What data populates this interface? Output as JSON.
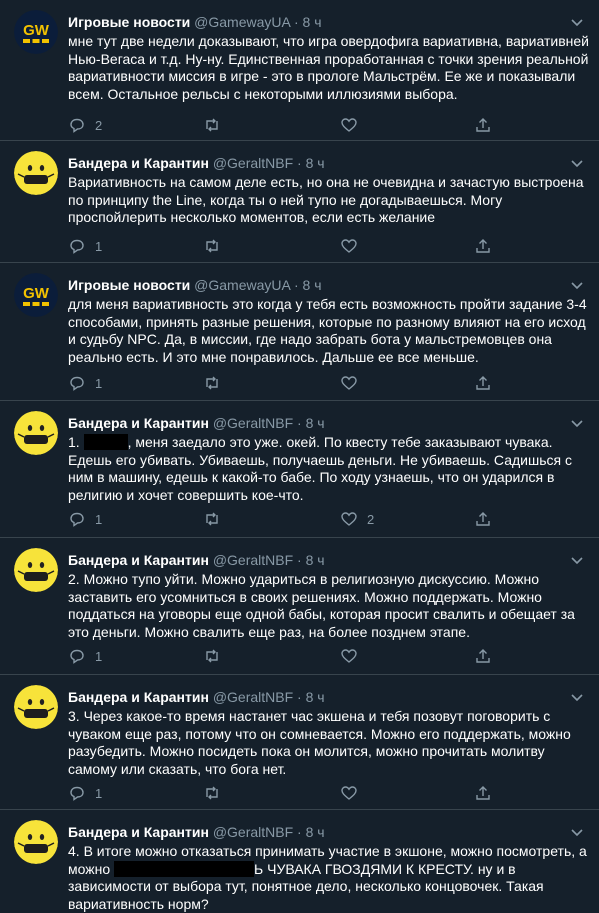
{
  "tweets": [
    {
      "name": "Игровые новости",
      "handle": "@GamewayUA",
      "dot": "·",
      "time": "8 ч",
      "avatar": "gameway-logo-icon",
      "lines": [
        "мне тут две недели доказывают, что игра овердофига вариативна, вариативней Нью-Вегаса и т.д. Ну-ну. Единственная проработанная с точки зрения реальной вариативности миссия в игре - это в прологе Мальстрём. Ее же и показывали всем. Остальное рельсы с некоторыми иллюзиями выбора."
      ],
      "reply_count": "2",
      "retweet_count": "",
      "like_count": ""
    },
    {
      "name": "Бандера и Карантин",
      "handle": "@GeraltNBF",
      "dot": "·",
      "time": "8 ч",
      "avatar": "smiley-mask-icon",
      "lines": [
        "Вариативность на самом деле есть, но она не очевидна и зачастую выстроена по принципу the Line, когда ты о ней тупо не догадываешься. Могу проспойлерить несколько моментов, если есть желание"
      ],
      "reply_count": "1",
      "retweet_count": "",
      "like_count": ""
    },
    {
      "name": "Игровые новости",
      "handle": "@GamewayUA",
      "dot": "·",
      "time": "8 ч",
      "avatar": "gameway-logo-icon",
      "lines": [
        "для меня вариативность это когда у тебя есть возможность пройти задание 3-4 способами, принять разные решения, которые по разному влияют на его исход и судьбу NPC. Да, в миссии, где надо забрать бота у мальстремовцев она реально есть. И это мне понравилось. Дальше ее все меньше."
      ],
      "reply_count": "1",
      "retweet_count": "",
      "like_count": ""
    },
    {
      "name": "Бандера и Карантин",
      "handle": "@GeraltNBF",
      "dot": "·",
      "time": "8 ч",
      "avatar": "smiley-mask-icon",
      "text_before": "1. ",
      "text_after": ", меня заедало это уже. окей. По квесту тебе заказывают чувака. Едешь его убивать. Убиваешь, получаешь деньги. Не убиваешь. Садишься с ним в машину, едешь к какой-то бабе. По ходу узнаешь, что он ударился в религию и хочет совершить кое-что.",
      "reply_count": "1",
      "retweet_count": "",
      "like_count": "2"
    },
    {
      "name": "Бандера и Карантин",
      "handle": "@GeraltNBF",
      "dot": "·",
      "time": "8 ч",
      "avatar": "smiley-mask-icon",
      "lines": [
        "2. Можно тупо уйти. Можно удариться в религиозную дискуссию. Можно заставить его усомниться в своих решениях. Можно поддержать. Можно поддаться на уговоры еще одной бабы, которая просит свалить и обещает за это деньги. Можно свалить еще раз, на более позднем этапе."
      ],
      "reply_count": "1",
      "retweet_count": "",
      "like_count": ""
    },
    {
      "name": "Бандера и Карантин",
      "handle": "@GeraltNBF",
      "dot": "·",
      "time": "8 ч",
      "avatar": "smiley-mask-icon",
      "lines": [
        "3. Через какое-то время настанет час экшена и тебя позовут поговорить с чуваком еще раз, потому что он сомневается. Можно его поддержать, можно разубедить. Можно посидеть пока он молится, можно прочитать молитву самому или сказать, что бога нет."
      ],
      "reply_count": "1",
      "retweet_count": "",
      "like_count": ""
    },
    {
      "name": "Бандера и Карантин",
      "handle": "@GeraltNBF",
      "dot": "·",
      "time": "8 ч",
      "avatar": "smiley-mask-icon",
      "text_before": "4. В итоге можно отказаться принимать участие в экшоне, можно посмотреть, а можно ",
      "text_after": "Ь ЧУВАКА ГВОЗДЯМИ К КРЕСТУ. ну и в зависимости от выбора тут, понятное дело, несколько концовочек. Такая вариативность норм?",
      "reply_count": "",
      "retweet_count": "",
      "like_count": ""
    }
  ],
  "colors": {
    "background": "#15202b",
    "divider": "#38444d",
    "muted": "#8899a6",
    "text": "#ffffff",
    "gameway_yellow": "#f2c200",
    "smiley_yellow": "#f7e33a"
  }
}
